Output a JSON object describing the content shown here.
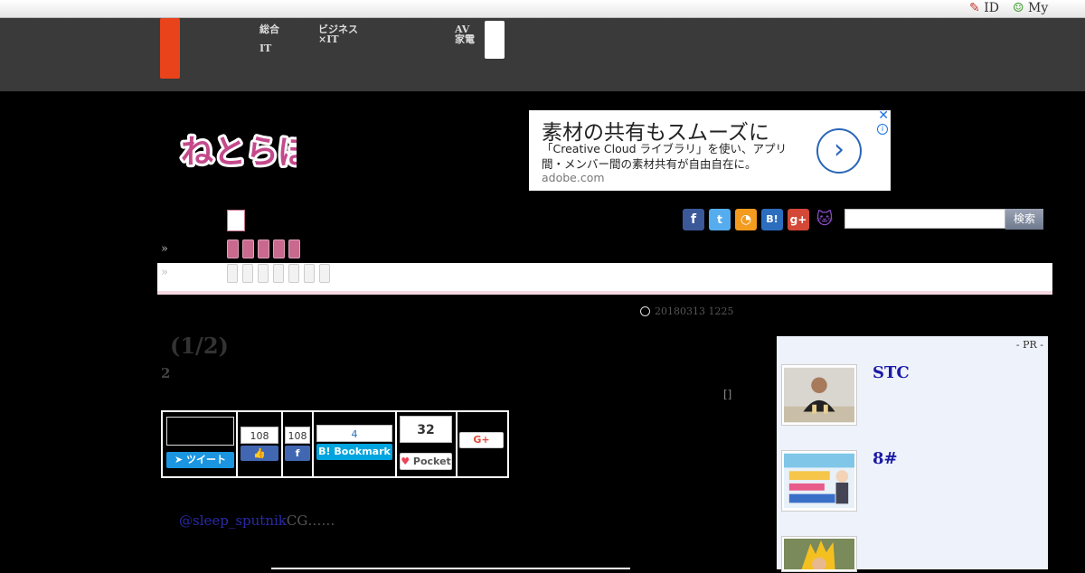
{
  "topbar": {
    "id_label": "ID",
    "my_label": "My"
  },
  "nav": {
    "item1_line1": "総合",
    "item1_line2": "IT",
    "item2_line1": "ビジネス",
    "item2_line2": "×IT",
    "item3_line1": "AV",
    "item3_line2": "家電"
  },
  "logo": {
    "text": "ねとらぼ"
  },
  "ad": {
    "headline": "素材の共有もスムーズに",
    "body": "「Creative Cloud ライブラリ」を使い、アプリ間・メンバー間の素材共有が自由自在に。",
    "domain": "adobe.com",
    "arrow": "›",
    "close": "✕",
    "info": "i"
  },
  "social": {
    "facebook": "f",
    "twitter": "t",
    "rss": "◔",
    "hatena": "B!",
    "googleplus": "g+",
    "cat": "🐱"
  },
  "search": {
    "button": "検索",
    "placeholder": ""
  },
  "breadcrumbs": {
    "raquo1": "»",
    "raquo2": "»"
  },
  "meta": {
    "date": "20180313 1225"
  },
  "article": {
    "title": "(1/2)",
    "subtitle": "2",
    "bracket": "[]"
  },
  "share": {
    "tweet_label": "ツイート",
    "like_count": "108",
    "fb_share_count": "108",
    "bookmark_count": "4",
    "bookmark_label": "Bookmark",
    "pocket_count": "32",
    "pocket_label": "Pocket",
    "gplus_label": "G+"
  },
  "body": {
    "mention": "@sleep_sputnik",
    "text": "CG……"
  },
  "sidebar": {
    "pr_label": "- PR -",
    "item1_title": "STC",
    "item2_title": "8#"
  },
  "colors": {
    "accent": "#e8431a",
    "pink": "#c9698e",
    "link": "#1a1aa6"
  }
}
